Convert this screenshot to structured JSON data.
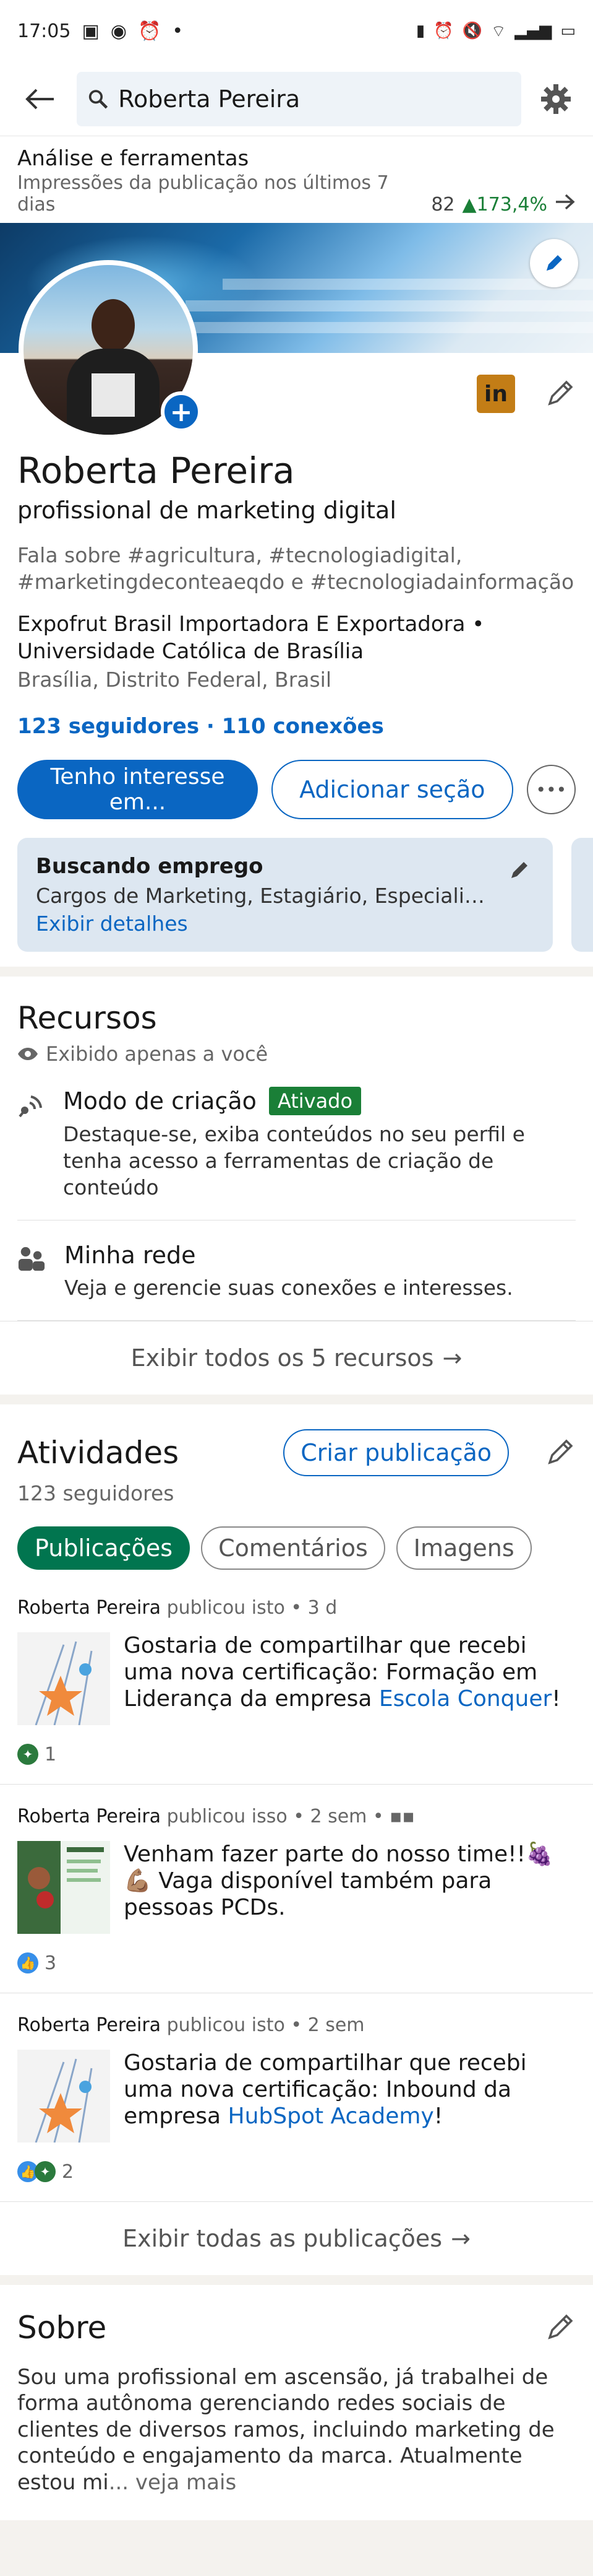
{
  "status_bar": {
    "time": "17:05",
    "battery": ""
  },
  "search": {
    "value": "Roberta Pereira"
  },
  "analytics": {
    "title": "Análise e ferramentas",
    "subtitle": "Impressões da publicação nos últimos 7 dias",
    "count": "82",
    "change": "173,4%"
  },
  "profile": {
    "name": "Roberta Pereira",
    "headline": "profissional de marketing digital",
    "talks_about": "Fala sobre #agricultura, #tecnologiadigital, #marketingdeconteaeqdo e #tecnologiadainformação",
    "company_line1": "Expofrut Brasil Importadora E Exportadora •",
    "company_line2": "Universidade Católica de Brasília",
    "location": "Brasília, Distrito Federal, Brasil",
    "followers_connections": "123 seguidores · 110 conexões",
    "btn_interest": "Tenho interesse em...",
    "btn_add_section": "Adicionar seção",
    "linkedin_badge": "in"
  },
  "open_to_work": {
    "title": "Buscando emprego",
    "text": "Cargos de Marketing, Estagiário, Especialista...",
    "link": "Exibir detalhes"
  },
  "resources": {
    "title": "Recursos",
    "private_label": "Exibido apenas a você",
    "items": [
      {
        "title": "Modo de criação",
        "badge": "Ativado",
        "desc": "Destaque-se, exiba conteúdos no seu perfil e tenha acesso a ferramentas de criação de conteúdo"
      },
      {
        "title": "Minha rede",
        "badge": "",
        "desc": "Veja e gerencie suas conexões e interesses."
      }
    ],
    "show_all": "Exibir todos os 5 recursos"
  },
  "activity": {
    "title": "Atividades",
    "create_button": "Criar publicação",
    "followers": "123 seguidores",
    "tabs": [
      "Publicações",
      "Comentários",
      "Imagens"
    ],
    "posts": [
      {
        "author": "Roberta Pereira",
        "meta": " publicou isto • 3 d",
        "text": "Gostaria de compartilhar que recebi uma nova certificação: Formação em Liderança da empresa ",
        "link": "Escola Conquer",
        "tail": "!",
        "reactions": "1"
      },
      {
        "author": "Roberta Pereira",
        "meta": " publicou isso • 2 sem • ",
        "text": "Venham fazer parte do nosso time!!🍇💪🏽 Vaga disponível também para pessoas PCDs.",
        "link": "",
        "tail": "",
        "reactions": "3"
      },
      {
        "author": "Roberta Pereira",
        "meta": " publicou isto • 2 sem",
        "text": "Gostaria de compartilhar que recebi uma nova certificação: Inbound da empresa ",
        "link": "HubSpot Academy",
        "tail": "!",
        "reactions": "2"
      }
    ],
    "show_all": "Exibir todas as publicações"
  },
  "about": {
    "title": "Sobre",
    "text": "Sou uma profissional em ascensão, já trabalhei de forma autônoma gerenciando redes sociais de clientes de diversos ramos, incluindo marketing de conteúdo e engajamento da marca. Atualmente estou mi",
    "more": "... veja mais"
  },
  "colors": {
    "accent": "#0a66c2",
    "active_green": "#01754f",
    "badge_green": "#1a7f37"
  }
}
